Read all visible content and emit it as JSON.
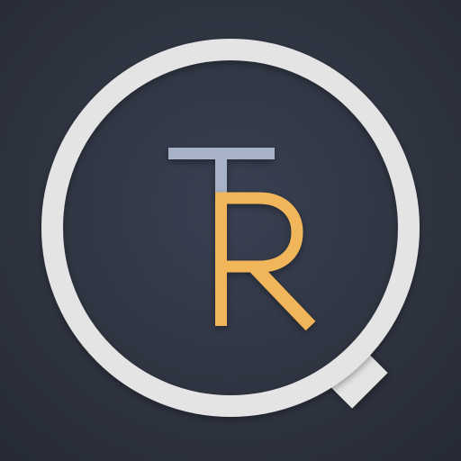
{
  "icon": {
    "name": "magnifier-tr-logo-icon",
    "letters": [
      "T",
      "R"
    ]
  },
  "colors": {
    "background": "#2f3441",
    "ring": "#e4e4e4",
    "letter_t": "#a9b3c8",
    "letter_r": "#f2b65a"
  }
}
